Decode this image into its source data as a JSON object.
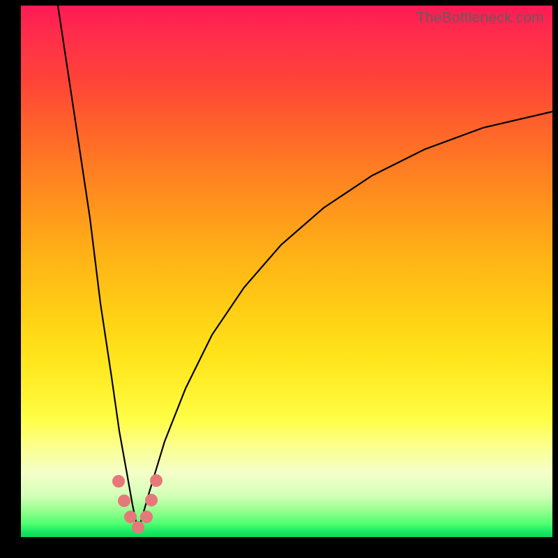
{
  "watermark": "TheBottleneck.com",
  "chart_data": {
    "type": "line",
    "title": "",
    "xlabel": "",
    "ylabel": "",
    "xlim": [
      0,
      100
    ],
    "ylim": [
      0,
      100
    ],
    "grid": false,
    "legend": false,
    "notes": "Bottleneck-style V-curve. Y≈100 means severe bottleneck (red), Y≈0 means balanced (green). Minimum sits near x≈22. Left branch is steep/near-vertical; right branch rises and saturates toward ~80.",
    "series": [
      {
        "name": "left-branch",
        "x": [
          7,
          10,
          13,
          15,
          17,
          18.5,
          20,
          21,
          22
        ],
        "values": [
          100,
          80,
          60,
          44,
          30,
          20,
          12,
          6,
          1
        ]
      },
      {
        "name": "right-branch",
        "x": [
          22,
          24,
          27,
          31,
          36,
          42,
          49,
          57,
          66,
          76,
          87,
          100
        ],
        "values": [
          1,
          8,
          18,
          28,
          38,
          47,
          55,
          62,
          68,
          73,
          77,
          80
        ]
      }
    ],
    "markers": {
      "name": "highlight-dots",
      "color": "#e6787a",
      "radius_px": 9,
      "points_xy": [
        [
          18.4,
          10.5
        ],
        [
          19.4,
          6.8
        ],
        [
          20.6,
          3.8
        ],
        [
          22.0,
          1.8
        ],
        [
          23.6,
          3.8
        ],
        [
          24.6,
          7.0
        ],
        [
          25.4,
          10.6
        ]
      ]
    },
    "background_gradient": {
      "top": "#ff1a55",
      "mid": "#ffe41b",
      "bottom": "#0ed95c"
    }
  }
}
